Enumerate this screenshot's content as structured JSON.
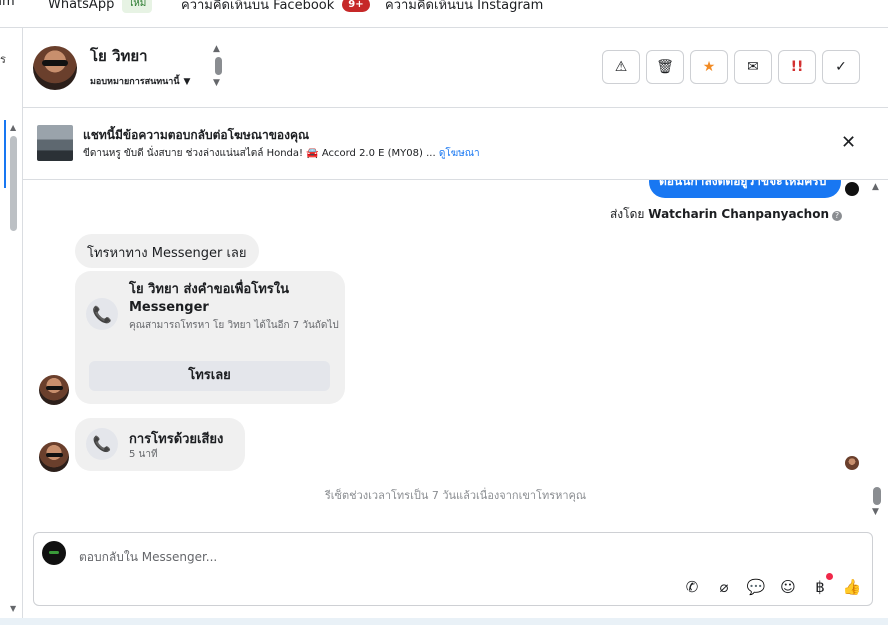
{
  "topnav": {
    "tabs": [
      {
        "label": "am"
      },
      {
        "label": "WhatsApp",
        "badge": "ใหม่"
      },
      {
        "label": "ความคิดเห็นบน Facebook",
        "badge": "9+"
      },
      {
        "label": "ความคิดเห็นบน Instagram"
      }
    ]
  },
  "leftstrip": {
    "edge_text": "ร"
  },
  "header": {
    "contact_name": "โย วิทยา",
    "assign_label": "มอบหมายการสนทนานี้"
  },
  "ad_banner": {
    "title": "แชทนี้มีข้อความตอบกลับต่อโฆษณาของคุณ",
    "subtitle": "ขีดานหรู ขับดี นั่งสบาย ช่วงล่างแน่นสไตล์ Honda! 🚘 Accord 2.0 E (MY08) ...",
    "link": "ดูโฆษณา"
  },
  "chat": {
    "sent_message": "ตอนนี้กำลังติดอยู่ว่าขจะใหม่ครับ",
    "sent_by_label": "ส่งโดย",
    "sent_by_name": "Watcharin Chanpanyachon",
    "pill_text": "โทรหาทาง Messenger เลย",
    "call_request_title": "โย วิทยา ส่งคำขอเพื่อโทรใน Messenger",
    "call_request_desc": "คุณสามารถโทรหา โย วิทยา ได้ในอีก 7 วันถัดไป",
    "call_button": "โทรเลย",
    "voice_call_title": "การโทรด้วยเสียง",
    "voice_call_duration": "5 นาที",
    "system_note": "รีเซ็ตช่วงเวลาโทรเป็น 7 วันแล้วเนื่องจากเขาโทรหาคุณ"
  },
  "composer": {
    "placeholder": "ตอบกลับใน Messenger..."
  },
  "colors": {
    "accent": "#1877f2",
    "star": "#f28b24",
    "spam": "#d32f2f",
    "badge_red": "#c62828"
  }
}
